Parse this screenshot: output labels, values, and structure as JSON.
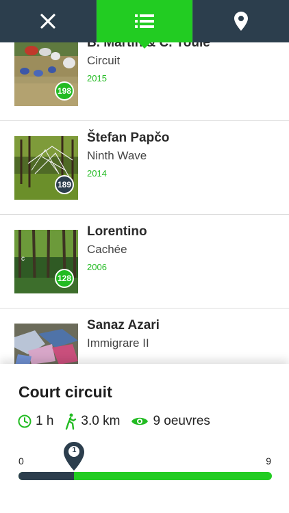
{
  "toolbar": {
    "tabs": [
      {
        "name": "close",
        "icon": "close-icon"
      },
      {
        "name": "list",
        "icon": "list-icon",
        "active": true
      },
      {
        "name": "map",
        "icon": "map-pin-icon"
      }
    ]
  },
  "artworks": [
    {
      "artist": "B. Martin & C. Youle",
      "title": "Circuit",
      "year": "2015",
      "number": "198",
      "badge": "green"
    },
    {
      "artist": "Štefan Papčo",
      "title": "Ninth Wave",
      "year": "2014",
      "number": "189",
      "badge": "dark"
    },
    {
      "artist": "Lorentino",
      "title": "Cachée",
      "year": "2006",
      "number": "128",
      "badge": "green"
    },
    {
      "artist": "Sanaz Azari",
      "title": "Immigrare II",
      "year": "",
      "number": "",
      "badge": "dark"
    }
  ],
  "route": {
    "title": "Court circuit",
    "duration": "1 h",
    "distance": "3.0 km",
    "works": "9 oeuvres",
    "progress_min": "0",
    "progress_max": "9",
    "progress_current": "1",
    "progress_fraction": 0.22
  },
  "colors": {
    "accent": "#22cc22",
    "dark": "#2c3e4d"
  }
}
